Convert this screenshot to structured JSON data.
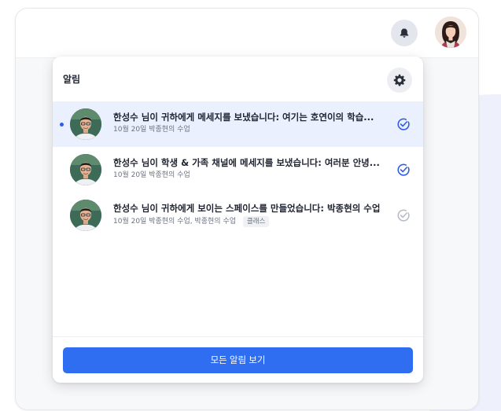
{
  "header": {
    "bell_icon": "bell-icon",
    "avatar_icon": "user-avatar"
  },
  "panel": {
    "title": "알림",
    "settings_icon": "gear-icon",
    "items": [
      {
        "unread": true,
        "title": "한성수 님이 귀하에게 메세지를 보냈습니다: 여기는 호연이의 학습...",
        "date": "10월 20일",
        "course": "박종현의 수업",
        "tag": "",
        "check_icon": "check-circle-icon",
        "check_color": "#2f5bea"
      },
      {
        "unread": false,
        "title": "한성수 님이 학생 & 가족 채널에 메세지를 보냈습니다: 여러분 안녕...",
        "date": "10월 20일",
        "course": "박종현의 수업",
        "tag": "",
        "check_icon": "check-circle-icon",
        "check_color": "#2f5bea"
      },
      {
        "unread": false,
        "title": "한성수 님이 귀하에게 보이는 스페이스를 만들었습니다: 박종현의 수업",
        "date": "10월 20일",
        "course": "박종현의 수업, 박종현의 수업",
        "tag": "클래스",
        "check_icon": "check-circle-icon",
        "check_color": "#b8bcc6"
      }
    ],
    "view_all_label": "모든 알림 보기"
  },
  "colors": {
    "accent": "#2f6ef0",
    "unread_bg": "#eaf0fd",
    "unread_dot": "#2f5bea"
  }
}
